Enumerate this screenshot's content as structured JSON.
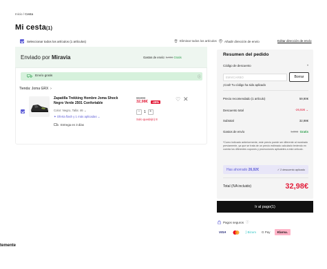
{
  "breadcrumb": {
    "home": "Inicio",
    "separator": " / ",
    "current": "Cesta"
  },
  "page": {
    "title": "Mi cesta",
    "count": "(1)"
  },
  "cart": {
    "select_all": "Seleccionar todos los artículos (1 artículos)",
    "delete_all": "Eliminar todos los artículos",
    "shipped_by_prefix": "Enviado por",
    "shipped_by_brand": "Miravia",
    "shipping_cost_label": "Gastos de envío:",
    "shipping_cost_old": "5,99€",
    "shipping_cost_value": "Gratis",
    "free_shipping": "Envío gratis",
    "store": "Tienda: Joma GRX",
    "item": {
      "name": "Zapatilla Trekking Hombre Joma Shock Negro Verde 2501 Confortable",
      "color": "Color: Negro, Talla: 46",
      "flash": "Oferta flash y 1 más aplicadas",
      "delivery": "Entrega en 3 días",
      "old_price": "59,90€",
      "new_price": "32,98€",
      "discount_badge": "-45%",
      "quantity": "1",
      "stock": "Solo queda(n) 8"
    }
  },
  "address": {
    "add": "Añadir dirección de envío",
    "edit": "Editar dirección de envío"
  },
  "summary": {
    "title": "Resumen del pedido",
    "discount_code_label": "Código de descuento",
    "discount_code_placeholder": "EMVICARBO",
    "clear_button": "Borrar",
    "code_applied": "¡Cool! Tu código ha sido aplicado",
    "recommended_label": "Precio recomendado (1 artículo)",
    "recommended_value": "59,90€",
    "discount_label": "Descuento total",
    "discount_value": "-26,92€",
    "subtotal_label": "Subtotal",
    "subtotal_value": "32,98€",
    "shipping_label": "Gastos de envío",
    "shipping_old": "5,99€",
    "shipping_value": "Gratis",
    "note": "*Como indicado anteriormente, este precio puede ser diferente al mostrado previamente, ya que se trata de un precio estimado calculado teniendo en cuenta los diferentes cupones y promociones aplicables a este artículo.",
    "saved_label": "Has ahorrado",
    "saved_value": "26,92€",
    "saved_discounts": "2 descuento aplicado",
    "total_label": "Total (IVA incluido)",
    "total_value": "32,98€",
    "pay_button": "Ir al pago(1)",
    "secure_payments": "Pagos seguros",
    "payment_methods": [
      "VISA",
      "Mastercard",
      "Bizum",
      "G Pay",
      "Klarna."
    ]
  },
  "footer": {
    "partial_title": "temente"
  },
  "colors": {
    "accent": "#5b5bd6",
    "price_red": "#e21d3a",
    "green": "#2a9d4a",
    "free_bg": "#d6f1dc"
  }
}
